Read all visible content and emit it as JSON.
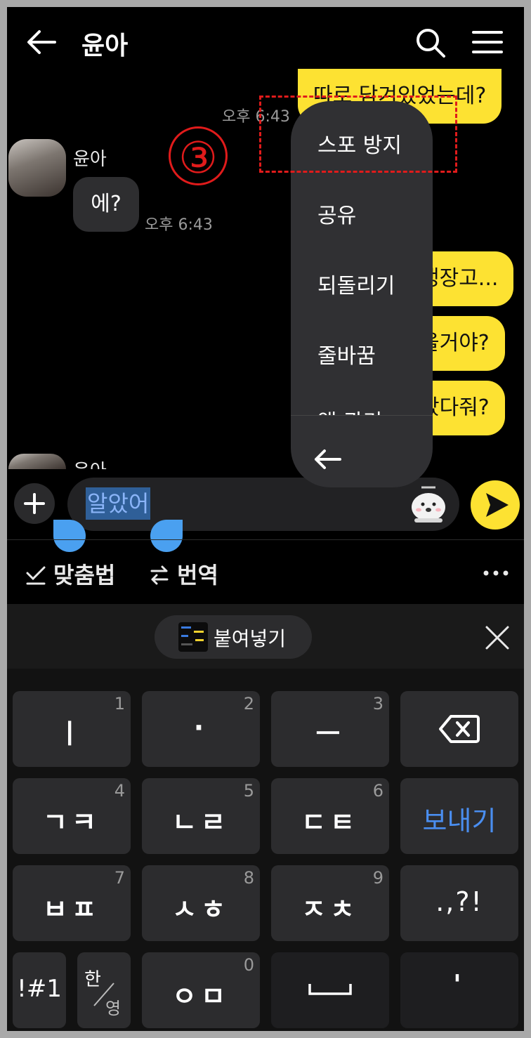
{
  "header": {
    "title": "윤아",
    "back_icon": "arrow-left-icon",
    "search_icon": "search-icon",
    "menu_icon": "hamburger-menu-icon"
  },
  "chat": {
    "messages": [
      {
        "side": "right",
        "text": "따로 담겨있었는데?",
        "time": "오후 6:43"
      },
      {
        "side": "left",
        "sender": "윤아",
        "text": "에?",
        "time": "오후 6:43"
      },
      {
        "side": "right",
        "text": "냉장고..."
      },
      {
        "side": "right",
        "text": "올거야?"
      },
      {
        "side": "right",
        "text": "갔다줘?"
      },
      {
        "side": "left",
        "sender": "윤아"
      }
    ]
  },
  "annotation": {
    "step_number": "③",
    "color": "#e01b1b"
  },
  "context_menu": {
    "items": [
      "스포 방지",
      "공유",
      "되돌리기",
      "줄바꿈",
      "앱 관리"
    ],
    "back_icon": "arrow-left-icon"
  },
  "composer": {
    "input_value": "알았어",
    "plus_icon": "plus-icon",
    "sticker_icon": "emoticon-icon",
    "send_icon": "send-icon"
  },
  "toolbar": {
    "spellcheck_label": "맞춤법",
    "translate_label": "번역",
    "more_icon": "more-horizontal-icon"
  },
  "keyboard": {
    "paste_label": "붙여넣기",
    "close_icon": "close-icon",
    "rows": [
      [
        {
          "label": "ㅣ",
          "hint": "1"
        },
        {
          "label": "·",
          "hint": "2"
        },
        {
          "label": "ㅡ",
          "hint": "3"
        },
        {
          "label": "",
          "icon": "backspace-icon"
        }
      ],
      [
        {
          "label": "ㄱㅋ",
          "hint": "4"
        },
        {
          "label": "ㄴㄹ",
          "hint": "5"
        },
        {
          "label": "ㄷㅌ",
          "hint": "6"
        },
        {
          "label": "보내기"
        }
      ],
      [
        {
          "label": "ㅂㅍ",
          "hint": "7"
        },
        {
          "label": "ㅅㅎ",
          "hint": "8"
        },
        {
          "label": "ㅈㅊ",
          "hint": "9"
        },
        {
          "label": ".,?!"
        }
      ],
      [
        {
          "label": "!#1"
        },
        {
          "label": "한",
          "sub": "영"
        },
        {
          "label": "ㅇㅁ",
          "hint": "0"
        },
        {
          "label": "",
          "icon": "space-icon"
        },
        {
          "label": "'"
        }
      ]
    ],
    "accent_color": "#4a8ef0"
  }
}
